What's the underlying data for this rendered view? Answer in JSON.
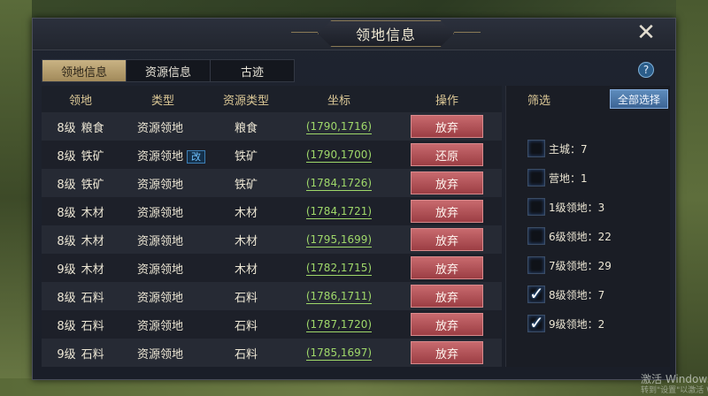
{
  "window": {
    "title": "领地信息"
  },
  "tabs": [
    {
      "label": "领地信息",
      "active": true
    },
    {
      "label": "资源信息",
      "active": false
    },
    {
      "label": "古迹",
      "active": false
    }
  ],
  "table": {
    "headers": [
      "领地",
      "类型",
      "资源类型",
      "坐标",
      "操作"
    ],
    "rows": [
      {
        "level": "8级",
        "name": "粮食",
        "type": "资源领地",
        "badge": "",
        "resource": "粮食",
        "coord": "(1790,1716)",
        "action": "放弃"
      },
      {
        "level": "8级",
        "name": "铁矿",
        "type": "资源领地",
        "badge": "改",
        "resource": "铁矿",
        "coord": "(1790,1700)",
        "action": "还原"
      },
      {
        "level": "8级",
        "name": "铁矿",
        "type": "资源领地",
        "badge": "",
        "resource": "铁矿",
        "coord": "(1784,1726)",
        "action": "放弃"
      },
      {
        "level": "8级",
        "name": "木材",
        "type": "资源领地",
        "badge": "",
        "resource": "木材",
        "coord": "(1784,1721)",
        "action": "放弃"
      },
      {
        "level": "8级",
        "name": "木材",
        "type": "资源领地",
        "badge": "",
        "resource": "木材",
        "coord": "(1795,1699)",
        "action": "放弃"
      },
      {
        "level": "9级",
        "name": "木材",
        "type": "资源领地",
        "badge": "",
        "resource": "木材",
        "coord": "(1782,1715)",
        "action": "放弃"
      },
      {
        "level": "8级",
        "name": "石料",
        "type": "资源领地",
        "badge": "",
        "resource": "石料",
        "coord": "(1786,1711)",
        "action": "放弃"
      },
      {
        "level": "8级",
        "name": "石料",
        "type": "资源领地",
        "badge": "",
        "resource": "石料",
        "coord": "(1787,1720)",
        "action": "放弃"
      },
      {
        "level": "9级",
        "name": "石料",
        "type": "资源领地",
        "badge": "",
        "resource": "石料",
        "coord": "(1785,1697)",
        "action": "放弃"
      }
    ]
  },
  "filter": {
    "label": "筛选",
    "select_all": "全部选择",
    "items": [
      {
        "label": "主城：7",
        "checked": false
      },
      {
        "label": "营地：1",
        "checked": false
      },
      {
        "label": "1级领地：3",
        "checked": false
      },
      {
        "label": "6级领地：22",
        "checked": false
      },
      {
        "label": "7级领地：29",
        "checked": false
      },
      {
        "label": "8级领地：7",
        "checked": true
      },
      {
        "label": "9级领地：2",
        "checked": true
      }
    ]
  },
  "watermark": {
    "line1": "激活 Windows",
    "line2": "转到\"设置\"以激活 W"
  },
  "icons": {
    "close": "close-icon",
    "help": "help-icon",
    "check": "check-icon"
  },
  "colors": {
    "accent_gold": "#dcc896",
    "button_red": "#c86a6e",
    "coord_green": "#9fd86a",
    "button_blue": "#5e8cbc"
  }
}
